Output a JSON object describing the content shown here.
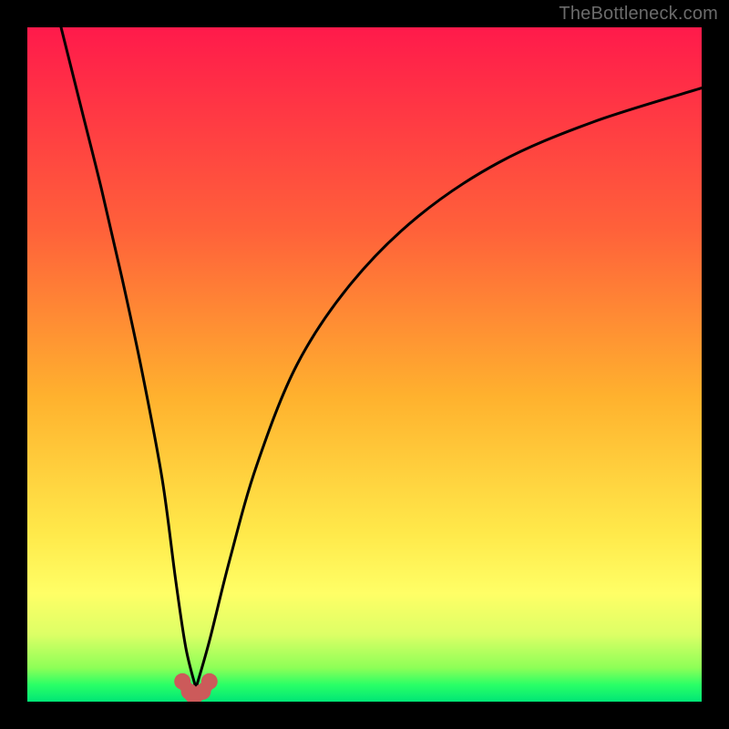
{
  "watermark": {
    "text": "TheBottleneck.com"
  },
  "chart_data": {
    "type": "line",
    "title": "",
    "xlabel": "",
    "ylabel": "",
    "xlim": [
      0,
      100
    ],
    "ylim": [
      0,
      100
    ],
    "grid": false,
    "legend": false,
    "gradient_stops": [
      {
        "offset": 0,
        "color": "#ff1a4b"
      },
      {
        "offset": 0.3,
        "color": "#ff613a"
      },
      {
        "offset": 0.55,
        "color": "#ffb22e"
      },
      {
        "offset": 0.75,
        "color": "#ffe94a"
      },
      {
        "offset": 0.84,
        "color": "#ffff66"
      },
      {
        "offset": 0.9,
        "color": "#ddff66"
      },
      {
        "offset": 0.95,
        "color": "#8dff57"
      },
      {
        "offset": 0.975,
        "color": "#2aff66"
      },
      {
        "offset": 1.0,
        "color": "#00e676"
      }
    ],
    "series": [
      {
        "name": "bottleneck-curve-left",
        "x": [
          5,
          8,
          11,
          14,
          17,
          20,
          22,
          23.5,
          25
        ],
        "y": [
          100,
          88,
          76,
          63,
          49,
          33,
          18,
          8,
          2
        ]
      },
      {
        "name": "bottleneck-curve-right",
        "x": [
          25,
          27,
          30,
          34,
          40,
          48,
          58,
          70,
          84,
          100
        ],
        "y": [
          2,
          9,
          21,
          35,
          50,
          62,
          72,
          80,
          86,
          91
        ]
      },
      {
        "name": "highlight-markers",
        "x": [
          23,
          24,
          24.5,
          25,
          26,
          27
        ],
        "y": [
          3,
          1.5,
          1,
          1,
          1.5,
          3
        ]
      }
    ],
    "highlight_color": "#cc5a5a"
  }
}
